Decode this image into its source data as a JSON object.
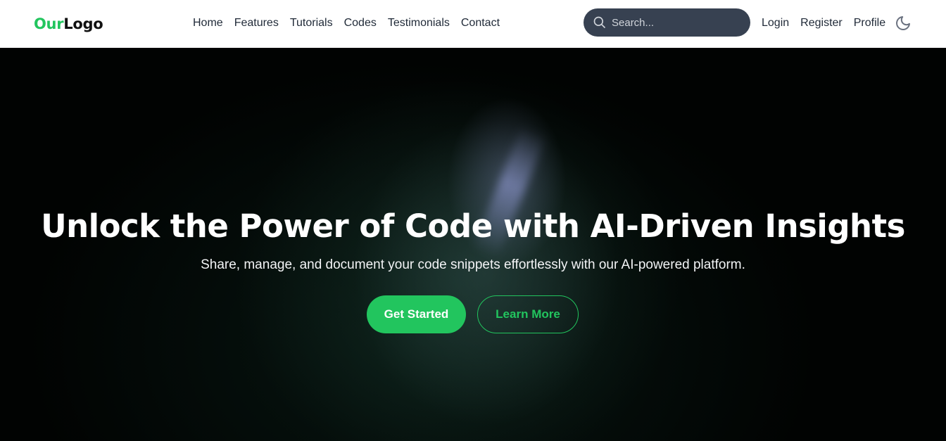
{
  "logo": {
    "accent": "Our",
    "rest": "Logo"
  },
  "nav": {
    "items": [
      "Home",
      "Features",
      "Tutorials",
      "Codes",
      "Testimonials",
      "Contact"
    ]
  },
  "search": {
    "placeholder": "Search...",
    "icon": "search-icon"
  },
  "user_nav": {
    "login": "Login",
    "register": "Register",
    "profile": "Profile",
    "theme_icon": "moon-icon"
  },
  "hero": {
    "title": "Unlock the Power of Code with AI-Driven Insights",
    "subtitle": "Share, manage, and document your code snippets effortlessly with our AI-powered platform.",
    "primary_button": "Get Started",
    "secondary_button": "Learn More"
  },
  "colors": {
    "accent": "#22c55e",
    "search_bg": "#374151",
    "nav_text": "#1f2937",
    "hero_bg": "#010302"
  }
}
